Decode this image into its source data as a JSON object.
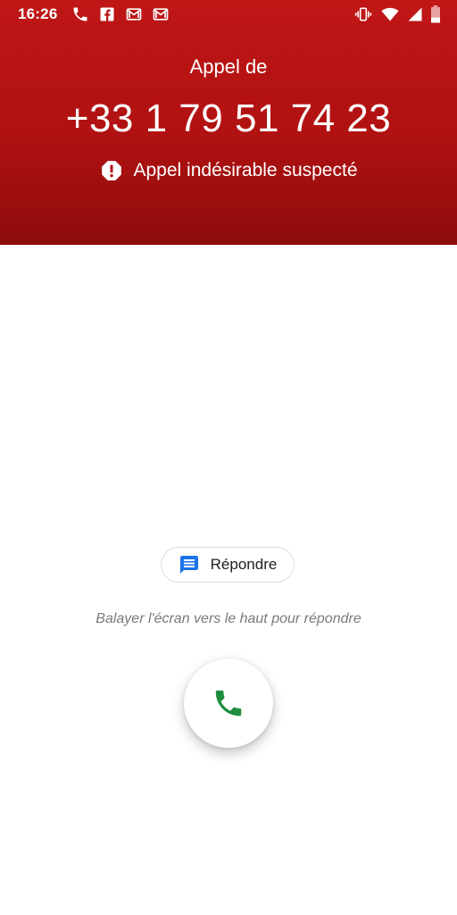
{
  "status_bar": {
    "time": "16:26",
    "left_icons": [
      "phone-icon",
      "facebook-icon",
      "gmail-icon",
      "gmail-icon"
    ],
    "right_icons": [
      "vibrate-icon",
      "wifi-icon",
      "signal-icon",
      "battery-icon"
    ]
  },
  "call": {
    "label": "Appel de",
    "number": "+33 1 79 51 74 23",
    "spam_warning": "Appel indésirable suspecté",
    "spam_icon": "warning-octagon-icon"
  },
  "actions": {
    "reply_label": "Répondre",
    "reply_icon": "message-icon",
    "swipe_hint": "Balayer l'écran vers le haut pour répondre",
    "answer_icon": "phone-answer-icon"
  },
  "colors": {
    "header_red": "#b01111",
    "answer_green": "#1e8e3e",
    "message_blue": "#1a73e8",
    "hint_gray": "#7a7a7a"
  }
}
